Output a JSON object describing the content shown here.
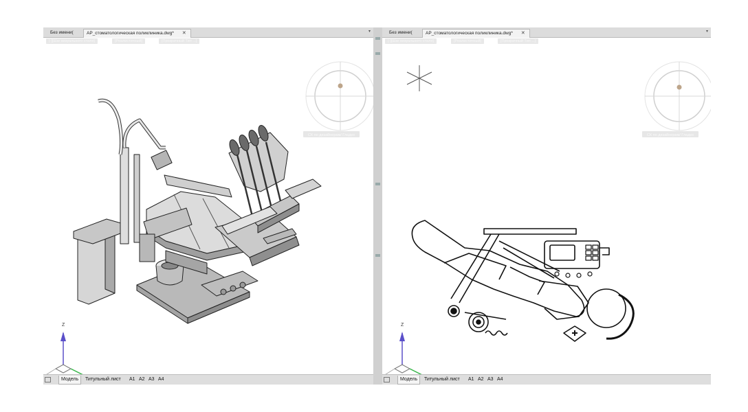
{
  "left_window": {
    "tabs": {
      "inactive_label": "Без имени(",
      "active_label": "АР_стоматологическая поликлиника.dwg*",
      "close_glyph": "✕",
      "menu_glyph": "▾"
    },
    "view_controls": [
      "[-][Шаг визуального стиля]",
      "[Реалистичный]",
      "[Прозрачный Тип ...]"
    ],
    "viewcube_label": "СК по дизайнерам/ Гладко",
    "status_tabs": [
      {
        "label": "Модель",
        "active": true
      },
      {
        "label": "Титульный лист",
        "active": false
      },
      {
        "label": "А1",
        "active": false
      },
      {
        "label": "А2",
        "active": false
      },
      {
        "label": "А3",
        "active": false
      },
      {
        "label": "А4",
        "active": false
      }
    ],
    "axis_label_z": "Z"
  },
  "right_window": {
    "tabs": {
      "inactive_label": "Без имени(",
      "active_label": "АР_стоматологическая поликлиника.dwg*",
      "close_glyph": "✕",
      "menu_glyph": "▾"
    },
    "view_controls": [
      "[-][Шаг визуального стиля]",
      "[Реалистичный]",
      "[Прозрачный Тип ...]"
    ],
    "viewcube_label": "СК по дизайнерам/ Гладко",
    "status_tabs": [
      {
        "label": "Модель",
        "active": true
      },
      {
        "label": "Титульный лист",
        "active": false
      },
      {
        "label": "А1",
        "active": false
      },
      {
        "label": "А2",
        "active": false
      },
      {
        "label": "А3",
        "active": false
      },
      {
        "label": "А4",
        "active": false
      }
    ],
    "axis_label_z": "Z"
  },
  "colors": {
    "axis_z": "#5a4fc9",
    "axis_y": "#39b54a",
    "viewcube_dot": "#bda58a"
  }
}
